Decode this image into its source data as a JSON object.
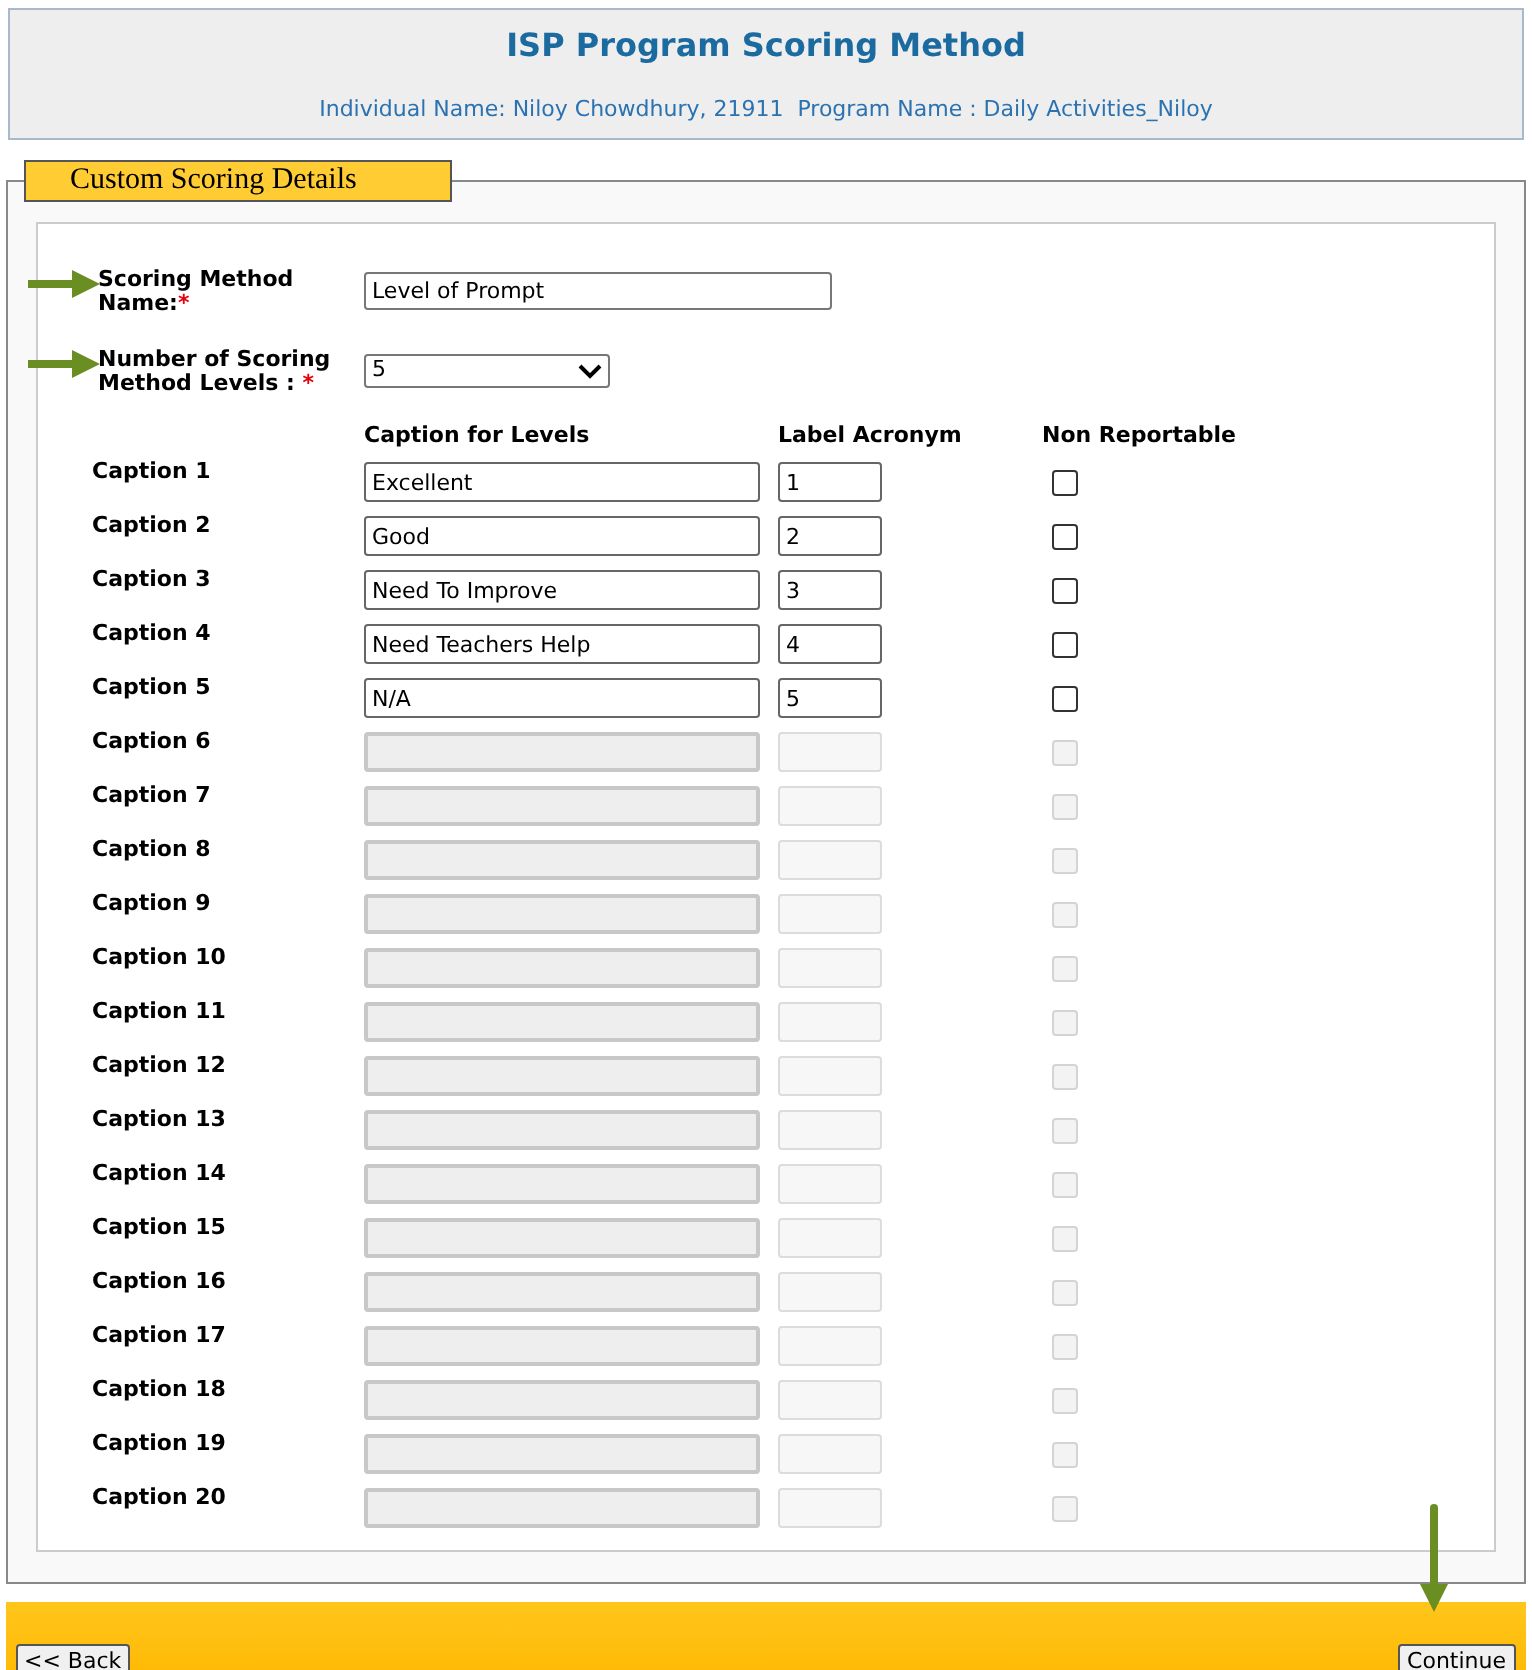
{
  "header": {
    "title": "ISP Program Scoring Method",
    "subtitle": "Individual Name: Niloy Chowdhury, 21911  Program Name : Daily Activities_Niloy"
  },
  "section_title": "Custom Scoring Details",
  "scoring_method_name": {
    "label": "Scoring Method Name:",
    "required_mark": "*",
    "value": "Level of Prompt"
  },
  "number_of_levels": {
    "label": "Number of Scoring Method Levels :",
    "required_mark": "*",
    "value": "5"
  },
  "columns": [
    "Caption for Levels",
    "Label Acronym",
    "Non Reportable"
  ],
  "rows": [
    {
      "label": "Caption 1",
      "caption": "Excellent",
      "acronym": "1",
      "checked": false,
      "disabled": false
    },
    {
      "label": "Caption 2",
      "caption": "Good",
      "acronym": "2",
      "checked": false,
      "disabled": false
    },
    {
      "label": "Caption 3",
      "caption": "Need To Improve",
      "acronym": "3",
      "checked": false,
      "disabled": false
    },
    {
      "label": "Caption 4",
      "caption": "Need Teachers Help",
      "acronym": "4",
      "checked": false,
      "disabled": false
    },
    {
      "label": "Caption 5",
      "caption": "N/A",
      "acronym": "5",
      "checked": false,
      "disabled": false
    },
    {
      "label": "Caption 6",
      "checked": false,
      "disabled": true
    },
    {
      "label": "Caption 7",
      "checked": false,
      "disabled": true
    },
    {
      "label": "Caption 8",
      "checked": false,
      "disabled": true
    },
    {
      "label": "Caption 9",
      "checked": false,
      "disabled": true
    },
    {
      "label": "Caption 10",
      "checked": false,
      "disabled": true
    },
    {
      "label": "Caption 11",
      "checked": false,
      "disabled": true
    },
    {
      "label": "Caption 12",
      "checked": false,
      "disabled": true
    },
    {
      "label": "Caption 13",
      "checked": false,
      "disabled": true
    },
    {
      "label": "Caption 14",
      "checked": false,
      "disabled": true
    },
    {
      "label": "Caption 15",
      "checked": false,
      "disabled": true
    },
    {
      "label": "Caption 16",
      "checked": false,
      "disabled": true
    },
    {
      "label": "Caption 17",
      "checked": false,
      "disabled": true
    },
    {
      "label": "Caption 18",
      "checked": false,
      "disabled": true
    },
    {
      "label": "Caption 19",
      "checked": false,
      "disabled": true
    },
    {
      "label": "Caption 20",
      "checked": false,
      "disabled": true
    }
  ],
  "buttons": {
    "back": "<< Back",
    "continue": "Continue"
  }
}
